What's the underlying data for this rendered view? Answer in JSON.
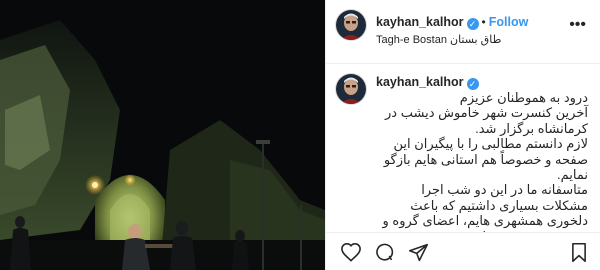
{
  "post": {
    "author": {
      "username": "kayhan_kalhor",
      "verified": true,
      "follow_label": "Follow",
      "separator": "•",
      "location": "Tagh-e Bostan طاق بستان"
    },
    "more_options": "•••",
    "caption": {
      "username": "kayhan_kalhor",
      "text": "درود به هموطنان عزیزم\nآخرین کنسرت شهر خاموش دیشب در کرمانشاه برگزار شد.\nلازم دانستم مطالبی را با پیگیران این صفحه و خصوصاً هم استانی هایم بازگو نمایم.\nمتاسفانه ما در این دو شب اجرا مشکلات بسیاری داشتیم که باعث دلخوری همشهری هایم، اعضای گروه و بنده بود، مترصد زمان"
    },
    "colors": {
      "accent": "#3897f0",
      "text": "#262626",
      "border": "#efefef",
      "photo_bg": "#07090a",
      "stage_glow": "#8fa35a"
    },
    "icons": {
      "like": "heart-icon",
      "comment": "comment-icon",
      "share": "share-icon",
      "save": "bookmark-icon",
      "verified": "verified-badge-icon",
      "more": "more-options-icon"
    }
  }
}
